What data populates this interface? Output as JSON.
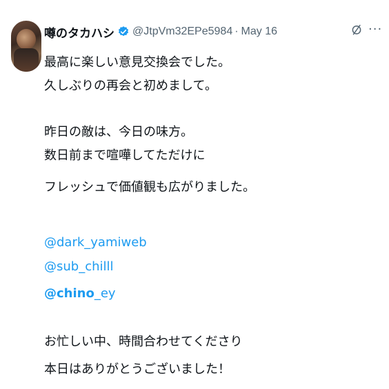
{
  "post": {
    "author": {
      "display_name": "噂のタカハシ",
      "handle": "@JtpVm32EPe5984",
      "separator": "·",
      "date": "May 16",
      "verified_color": "#1d9bf0",
      "verified_icon": "verified-badge-icon"
    },
    "body": {
      "paragraph1": [
        "最高に楽しい意見交換会でした。",
        "久しぶりの再会と初めまして。"
      ],
      "paragraph2": [
        "昨日の敵は、今日の味方。",
        "数日前まで喧嘩してただけに",
        "フレッシュで価値観も広がりました。"
      ],
      "mentions": [
        "@dark_yamiweb",
        "@sub_chilll"
      ],
      "mention3_bold": "@chino",
      "mention3_rest": "_ey",
      "paragraph3": [
        "お忙しい中、時間合わせてくださり",
        "本日はありがとうございました！"
      ]
    },
    "actions": {
      "grok_icon": "grok-slash-icon",
      "more_label": "···"
    }
  },
  "colors": {
    "text": "#0f1419",
    "secondary": "#536471",
    "link": "#1d9bf0"
  }
}
